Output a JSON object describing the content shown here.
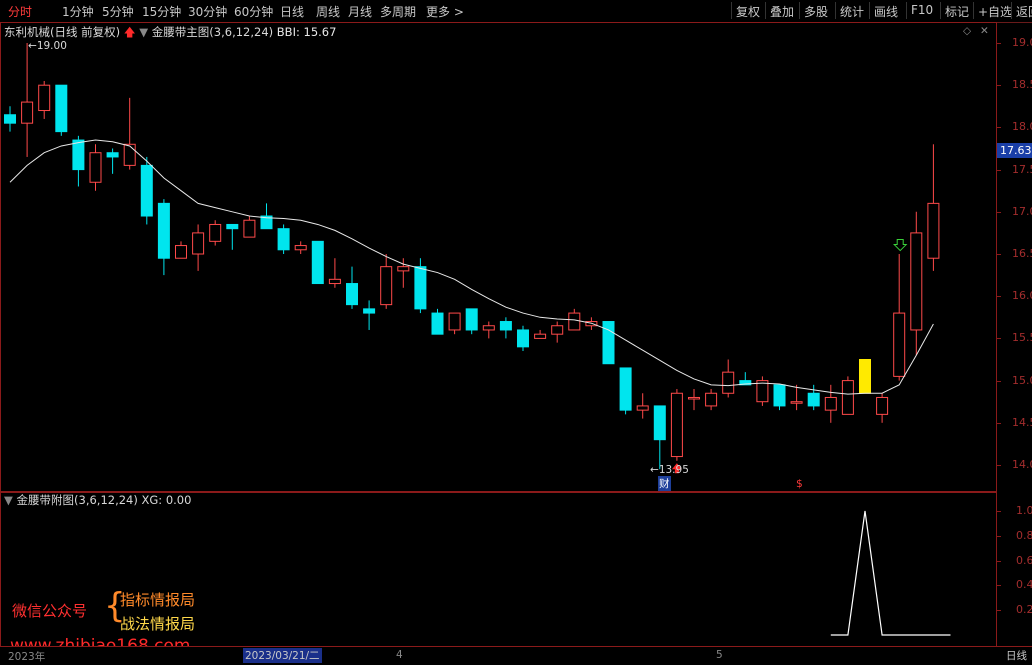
{
  "toolbar": {
    "left_items": [
      "分时",
      "1分钟",
      "5分钟",
      "15分钟",
      "30分钟",
      "60分钟",
      "日线",
      "周线",
      "月线",
      "多周期",
      "更多 >"
    ],
    "active_index": 0,
    "right_items": [
      "复权",
      "叠加",
      "多股",
      "统计",
      "画线",
      "F10",
      "标记",
      "+自选",
      "返回"
    ]
  },
  "main_panel": {
    "stock_name": "东利机械(日线 前复权)",
    "indicator_name": "金腰带主图(3,6,12,24)",
    "bbi_text": "BBI: 15.67",
    "high_label": "19.00",
    "low_label": "13.95",
    "price_tag": "17.63",
    "marker_cai": "财",
    "marker_dollar": "$",
    "y_axis": [
      "19.0",
      "18.5",
      "18.0",
      "17.5",
      "17.0",
      "16.5",
      "16.0",
      "15.5",
      "15.0",
      "14.5",
      "14.0"
    ]
  },
  "sub_panel": {
    "indicator_name": "金腰带附图(3,6,12,24)",
    "xg_text": "XG: 0.00",
    "y_axis": [
      "1.0",
      "0.8",
      "0.6",
      "0.4",
      "0.2"
    ]
  },
  "watermark": {
    "line1": "微信公众号",
    "line2": "指标情报局",
    "line3": "战法情报局",
    "url": "www.zhibiao168.com"
  },
  "bottom_bar": {
    "year": "2023年",
    "date": "2023/03/21/二",
    "month4": "4",
    "month5": "5",
    "period": "日线"
  },
  "colors": {
    "up": "#ff4a4a",
    "down": "#00e5ee",
    "bbi": "#e8e8e8",
    "signal": "#ffea00",
    "border": "#8b1a1a"
  },
  "chart_data": {
    "type": "candlestick",
    "ylim": [
      13.8,
      19.2
    ],
    "candles": [
      {
        "o": 18.15,
        "h": 18.25,
        "l": 17.95,
        "c": 18.05
      },
      {
        "o": 18.05,
        "h": 19.0,
        "l": 17.65,
        "c": 18.3
      },
      {
        "o": 18.2,
        "h": 18.55,
        "l": 18.1,
        "c": 18.5
      },
      {
        "o": 18.5,
        "h": 18.5,
        "l": 17.9,
        "c": 17.95
      },
      {
        "o": 17.85,
        "h": 17.9,
        "l": 17.3,
        "c": 17.5
      },
      {
        "o": 17.35,
        "h": 17.8,
        "l": 17.25,
        "c": 17.7
      },
      {
        "o": 17.7,
        "h": 17.75,
        "l": 17.45,
        "c": 17.65
      },
      {
        "o": 17.55,
        "h": 18.35,
        "l": 17.5,
        "c": 17.8
      },
      {
        "o": 17.55,
        "h": 17.65,
        "l": 16.85,
        "c": 16.95
      },
      {
        "o": 17.1,
        "h": 17.15,
        "l": 16.25,
        "c": 16.45
      },
      {
        "o": 16.45,
        "h": 16.65,
        "l": 16.45,
        "c": 16.6
      },
      {
        "o": 16.5,
        "h": 16.85,
        "l": 16.3,
        "c": 16.75
      },
      {
        "o": 16.65,
        "h": 16.9,
        "l": 16.6,
        "c": 16.85
      },
      {
        "o": 16.85,
        "h": 16.85,
        "l": 16.55,
        "c": 16.8
      },
      {
        "o": 16.7,
        "h": 16.95,
        "l": 16.7,
        "c": 16.9
      },
      {
        "o": 16.95,
        "h": 17.1,
        "l": 16.8,
        "c": 16.8
      },
      {
        "o": 16.8,
        "h": 16.85,
        "l": 16.5,
        "c": 16.55
      },
      {
        "o": 16.55,
        "h": 16.65,
        "l": 16.5,
        "c": 16.6
      },
      {
        "o": 16.65,
        "h": 16.65,
        "l": 16.15,
        "c": 16.15
      },
      {
        "o": 16.15,
        "h": 16.45,
        "l": 16.1,
        "c": 16.2
      },
      {
        "o": 16.15,
        "h": 16.35,
        "l": 15.85,
        "c": 15.9
      },
      {
        "o": 15.85,
        "h": 15.95,
        "l": 15.6,
        "c": 15.8
      },
      {
        "o": 15.9,
        "h": 16.5,
        "l": 15.85,
        "c": 16.35
      },
      {
        "o": 16.3,
        "h": 16.45,
        "l": 16.1,
        "c": 16.35
      },
      {
        "o": 16.35,
        "h": 16.45,
        "l": 15.8,
        "c": 15.85
      },
      {
        "o": 15.8,
        "h": 15.85,
        "l": 15.55,
        "c": 15.55
      },
      {
        "o": 15.6,
        "h": 15.8,
        "l": 15.55,
        "c": 15.8
      },
      {
        "o": 15.85,
        "h": 15.85,
        "l": 15.55,
        "c": 15.6
      },
      {
        "o": 15.6,
        "h": 15.7,
        "l": 15.5,
        "c": 15.65
      },
      {
        "o": 15.7,
        "h": 15.75,
        "l": 15.5,
        "c": 15.6
      },
      {
        "o": 15.6,
        "h": 15.65,
        "l": 15.35,
        "c": 15.4
      },
      {
        "o": 15.5,
        "h": 15.6,
        "l": 15.5,
        "c": 15.55
      },
      {
        "o": 15.55,
        "h": 15.7,
        "l": 15.45,
        "c": 15.65
      },
      {
        "o": 15.6,
        "h": 15.85,
        "l": 15.6,
        "c": 15.8
      },
      {
        "o": 15.65,
        "h": 15.75,
        "l": 15.6,
        "c": 15.7
      },
      {
        "o": 15.7,
        "h": 15.7,
        "l": 15.2,
        "c": 15.2
      },
      {
        "o": 15.15,
        "h": 15.15,
        "l": 14.6,
        "c": 14.65
      },
      {
        "o": 14.65,
        "h": 14.85,
        "l": 14.55,
        "c": 14.7
      },
      {
        "o": 14.7,
        "h": 14.7,
        "l": 13.95,
        "c": 14.3
      },
      {
        "o": 14.1,
        "h": 14.9,
        "l": 14.05,
        "c": 14.85
      },
      {
        "o": 14.8,
        "h": 14.9,
        "l": 14.65,
        "c": 14.8
      },
      {
        "o": 14.7,
        "h": 14.9,
        "l": 14.65,
        "c": 14.85
      },
      {
        "o": 14.85,
        "h": 15.25,
        "l": 14.8,
        "c": 15.1
      },
      {
        "o": 15.0,
        "h": 15.1,
        "l": 14.95,
        "c": 14.95
      },
      {
        "o": 14.75,
        "h": 15.05,
        "l": 14.7,
        "c": 15.0
      },
      {
        "o": 14.95,
        "h": 14.95,
        "l": 14.65,
        "c": 14.7
      },
      {
        "o": 14.75,
        "h": 14.95,
        "l": 14.65,
        "c": 14.75
      },
      {
        "o": 14.85,
        "h": 14.95,
        "l": 14.65,
        "c": 14.7
      },
      {
        "o": 14.65,
        "h": 14.95,
        "l": 14.5,
        "c": 14.8
      },
      {
        "o": 14.6,
        "h": 15.05,
        "l": 14.6,
        "c": 15.0
      },
      {
        "o": 14.85,
        "h": 15.25,
        "l": 14.85,
        "c": 15.25
      },
      {
        "o": 14.6,
        "h": 14.85,
        "l": 14.5,
        "c": 14.8
      },
      {
        "o": 15.05,
        "h": 16.5,
        "l": 15.0,
        "c": 15.8
      },
      {
        "o": 15.6,
        "h": 17.0,
        "l": 15.3,
        "c": 16.75
      },
      {
        "o": 16.45,
        "h": 17.8,
        "l": 16.3,
        "c": 17.1
      }
    ],
    "signal_index": 50,
    "bbi": [
      17.35,
      17.55,
      17.7,
      17.78,
      17.82,
      17.85,
      17.83,
      17.78,
      17.6,
      17.4,
      17.25,
      17.1,
      17.05,
      17.0,
      16.95,
      16.93,
      16.92,
      16.9,
      16.85,
      16.78,
      16.68,
      16.57,
      16.47,
      16.38,
      16.33,
      16.28,
      16.2,
      16.08,
      15.97,
      15.87,
      15.8,
      15.75,
      15.73,
      15.72,
      15.68,
      15.6,
      15.48,
      15.36,
      15.24,
      15.12,
      15.02,
      14.95,
      14.94,
      14.96,
      14.97,
      14.96,
      14.92,
      14.89,
      14.86,
      14.84,
      14.85,
      14.85,
      14.95,
      15.3,
      15.67
    ],
    "sub_series": [
      0,
      0,
      0,
      0,
      0,
      0,
      0,
      0,
      0,
      0,
      0,
      0,
      0,
      0,
      0,
      0,
      0,
      0,
      0,
      0,
      0,
      0,
      0,
      0,
      0,
      0,
      0,
      0,
      0,
      0,
      0,
      0,
      0,
      0,
      0,
      0,
      0,
      0,
      0,
      0,
      0,
      0,
      0,
      0,
      0,
      0,
      0,
      0,
      0,
      0,
      1,
      0,
      0,
      0,
      0
    ],
    "sub_ylim": [
      0,
      1.1
    ]
  }
}
